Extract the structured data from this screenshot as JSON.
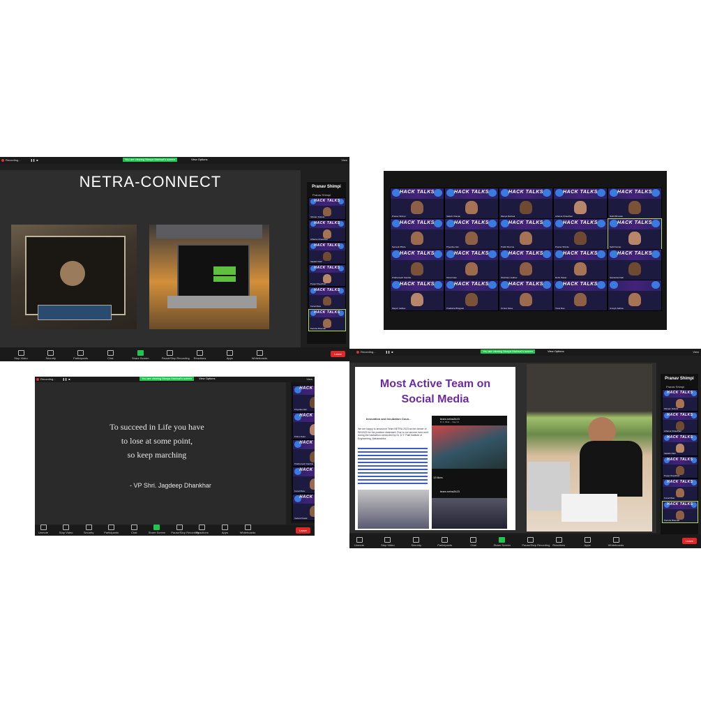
{
  "panel1": {
    "recording": "Recording...",
    "share_banner": "You are viewing Manya Mariwal's screen",
    "view_options": "View Options",
    "view": "View",
    "title": "NETRA-CONNECT",
    "sidebar_header": "Pranav Shimpi",
    "sidebar_sub": "Pranav Shimpi",
    "participants": [
      "Shivam Dubole",
      "Atharva Chaudhari",
      "Vaidehi Patil",
      "Pooja Chaudhari",
      "Kunal Mete",
      "Parinita Bhandar"
    ],
    "toolbar": [
      "Stop Video",
      "Security",
      "Participants",
      "Chat",
      "Share Screen",
      "Pause/Stop Recording",
      "Reactions",
      "Apps",
      "Whiteboards"
    ],
    "participants_count": "16",
    "leave": "Leave"
  },
  "panel2": {
    "tile_brand": "HACK TALKS",
    "names": [
      "Pranav Shimpi",
      "Sakshi Chavan",
      "Manya Mariwal",
      "Atharva Chaudhari",
      "Nikhil Bhosale",
      "Sarvesh Bhole",
      "Priyanka Jain",
      "Pratik Sharma",
      "Pranav Shinde",
      "Sahil Kamat",
      "Prathamesh Kamble",
      "Shruti Kale",
      "Shubham Jadhav",
      "Rohit Pawar",
      "Samiksha Patil",
      "Mayuri Jadhav",
      "Pratiksha Bhagwat",
      "Omkar Mane",
      "Vivek Rao",
      "Amogh Jadhav"
    ]
  },
  "panel3": {
    "recording": "Recording...",
    "share_banner": "You are viewing Manya Mariwal's screen",
    "view_options": "View Options",
    "view": "View",
    "quote_lines": [
      "To succeed in Life you have",
      "to lose at some point,",
      "so keep marching"
    ],
    "attribution": "- VP Shri. Jagdeep Dhankhar",
    "tile_brand": "HACK TALKS",
    "participants": [
      "Priyanka Jain",
      "Prithvi Dalvi",
      "Prathamesh Kamble",
      "Kunal Mete",
      "Vedant Pawar"
    ],
    "toolbar": [
      "Unmute",
      "Stop Video",
      "Security",
      "Participants",
      "Chat",
      "Share Screen",
      "Pause/Stop Recording",
      "Reactions",
      "Apps",
      "Whiteboards"
    ],
    "leave": "Leave"
  },
  "panel4": {
    "recording": "Recording...",
    "share_banner": "You are viewing Manya Mariwal's screen",
    "view_options": "View Options",
    "view": "View",
    "slide_title_1": "Most Active Team on",
    "slide_title_2": "Social Media",
    "post_header": "Innovation and Incubation Coun...",
    "post_body": "We are happy to announce Team NETRA 2023 as the winner of SIH2023 for the problem statement. Due to our sincere hard work during the hackathon conducted by Dr. D.Y. Patil Institute of Engineering, Maharashtra",
    "insta_handle": "team.netra2k23",
    "insta_caption": "B. K. Birla ... Day 01",
    "likes": "13 likes",
    "insta_handle2": "team.netra2k23",
    "sidebar_header": "Pranav Shimpi",
    "sidebar_sub": "Pranav Shimpi",
    "participants": [
      "Shivam Dubole",
      "Atharva Chaudhari",
      "Vaidehi Patil",
      "Pooja Chaudhari",
      "Kunal Mete",
      "Parinita Bhandar"
    ],
    "toolbar": [
      "Unmute",
      "Stop Video",
      "Security",
      "Participants",
      "Chat",
      "Share Screen",
      "Pause/Stop Recording",
      "Reactions",
      "Apps",
      "Whiteboards"
    ],
    "leave": "Leave"
  }
}
